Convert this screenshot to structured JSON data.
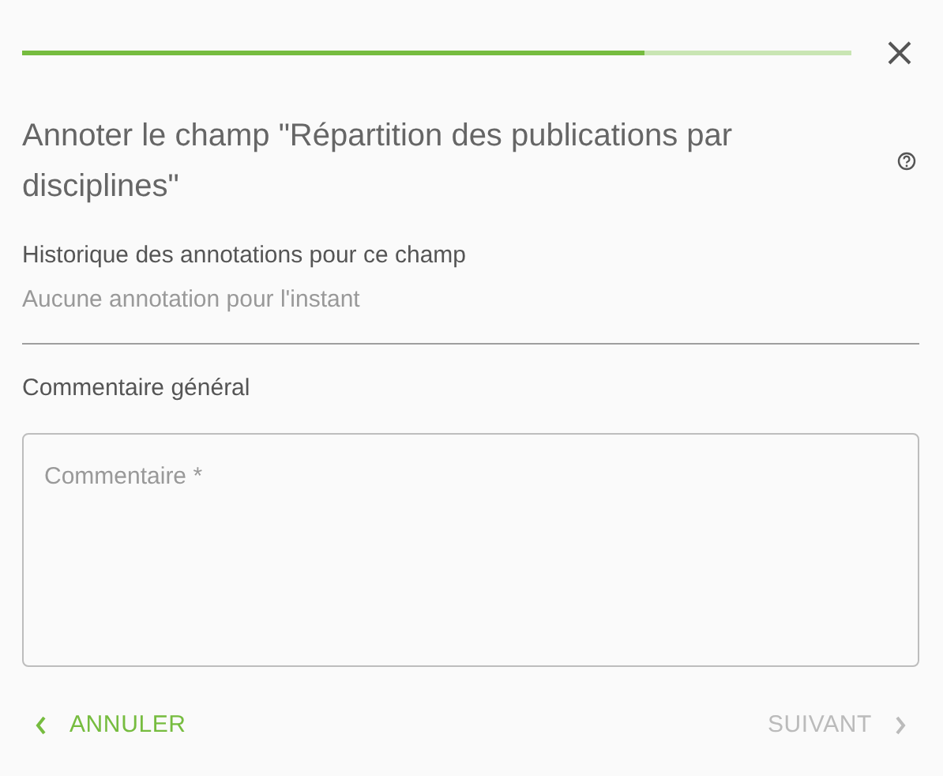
{
  "progress": {
    "level": 0.75
  },
  "title": "Annoter le champ \"Répartition des publications par disciplines\"",
  "history": {
    "label": "Historique des annotations pour ce champ",
    "empty_text": "Aucune annotation pour l'instant"
  },
  "comment": {
    "label": "Commentaire général",
    "placeholder": "Commentaire *"
  },
  "buttons": [
    {
      "label": "ANNULER",
      "kind": "back",
      "disabled": false
    },
    {
      "label": "SUIVANT",
      "kind": "next",
      "disabled": true
    }
  ]
}
